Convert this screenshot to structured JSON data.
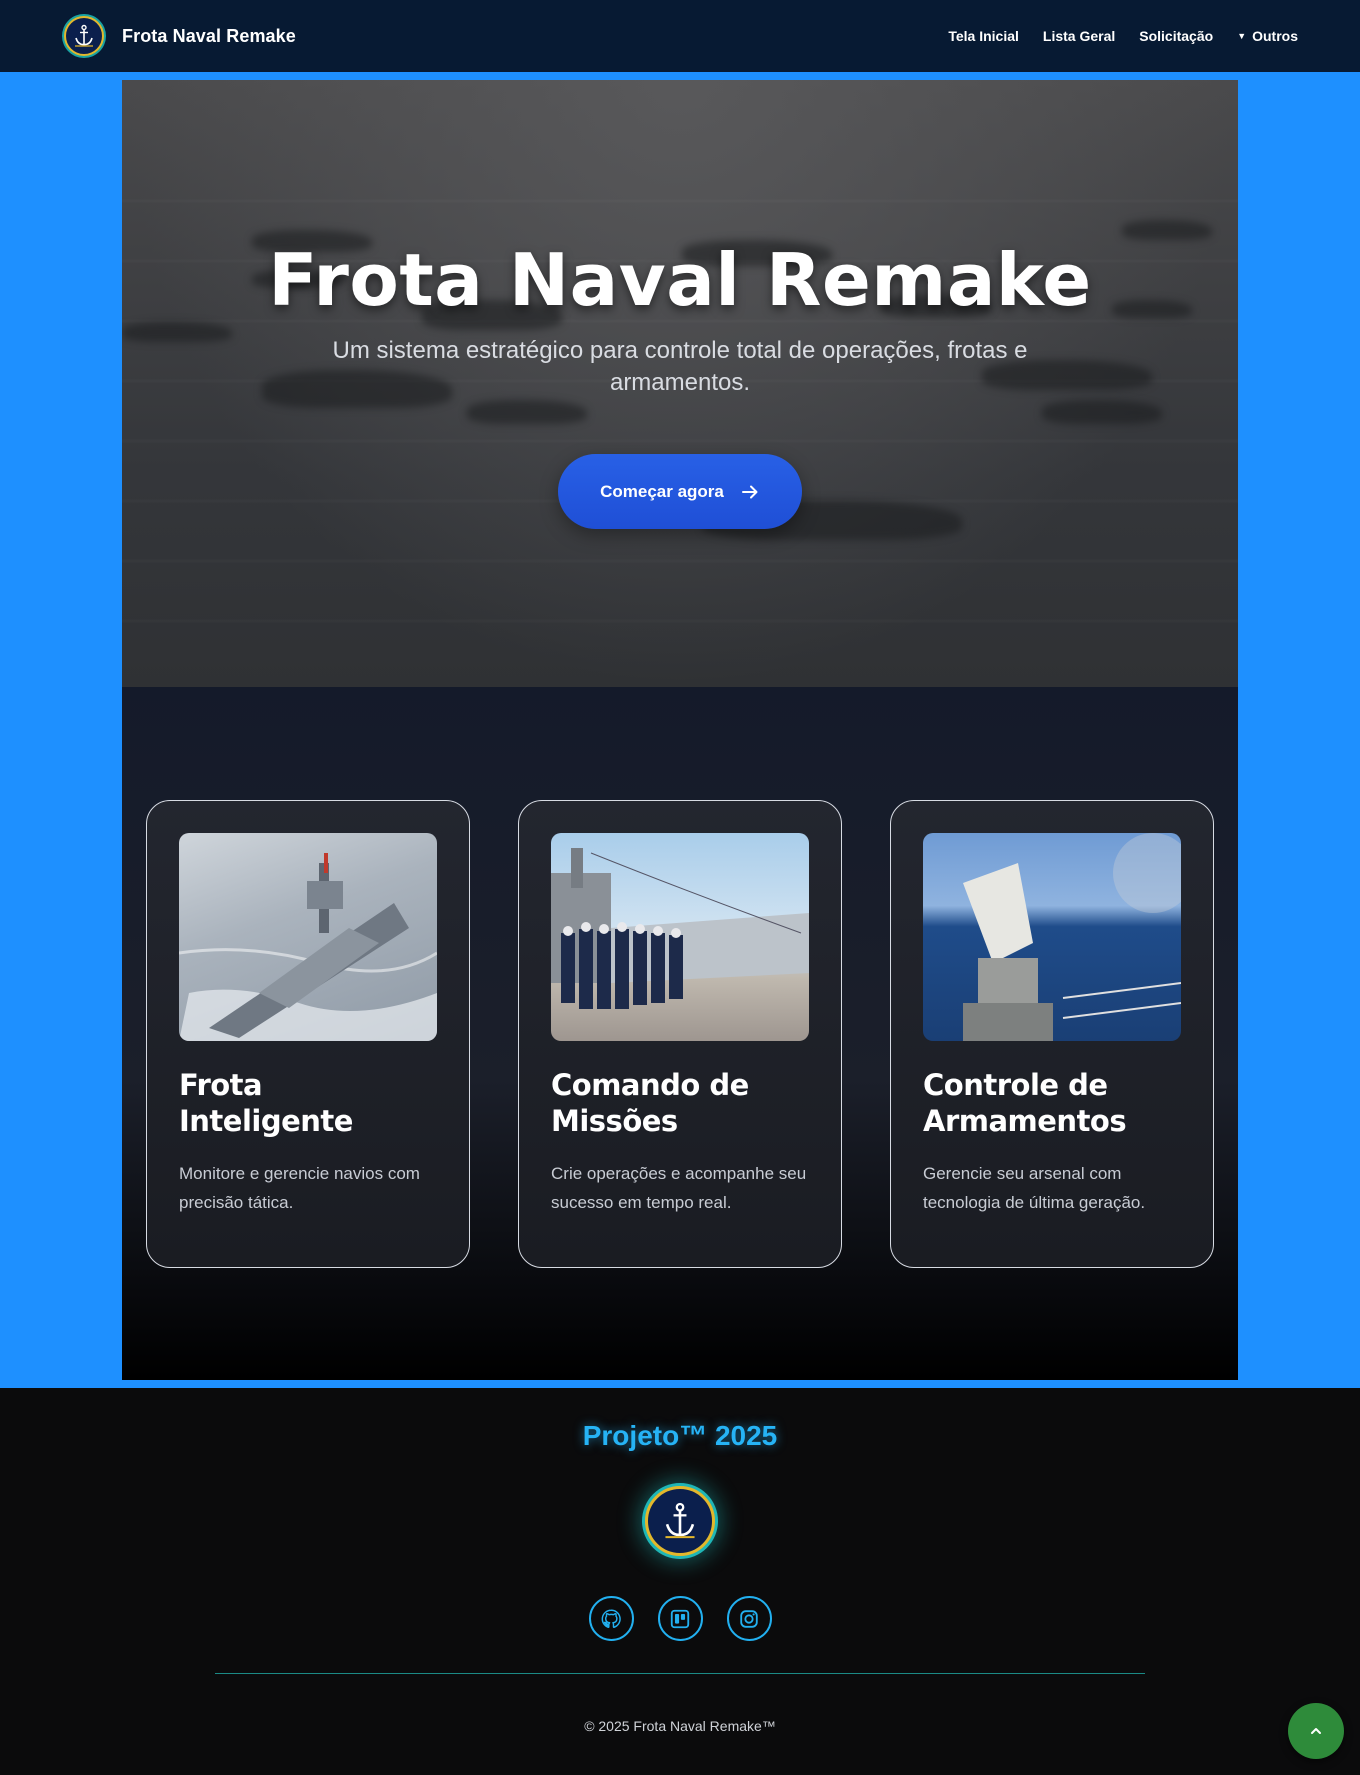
{
  "navbar": {
    "brand": "Frota Naval Remake",
    "links": [
      "Tela Inicial",
      "Lista Geral",
      "Solicitação"
    ],
    "dropdown_label": "Outros"
  },
  "hero": {
    "title": "Frota Naval Remake",
    "subtitle": "Um sistema estratégico para controle total de operações, frotas e armamentos.",
    "cta_label": "Começar agora"
  },
  "cards": [
    {
      "title": "Frota Inteligente",
      "description": "Monitore e gerencie navios com precisão tática.",
      "image": "warship-photo"
    },
    {
      "title": "Comando de Missões",
      "description": "Crie operações e acompanhe seu sucesso em tempo real.",
      "image": "sailors-ceremony-photo"
    },
    {
      "title": "Controle de Armamentos",
      "description": "Gerencie seu arsenal com tecnologia de última geração.",
      "image": "naval-gun-photo"
    }
  ],
  "footer": {
    "title": "Projeto™ 2025",
    "social": [
      "github-icon",
      "trello-icon",
      "instagram-icon"
    ],
    "copyright": "© 2025 Frota Naval Remake™"
  },
  "colors": {
    "navbar_bg": "#071a33",
    "page_bg": "#1e90ff",
    "cta": "#2860e6",
    "footer_accent": "#26b3f5",
    "back_to_top": "#2e8b3a"
  }
}
